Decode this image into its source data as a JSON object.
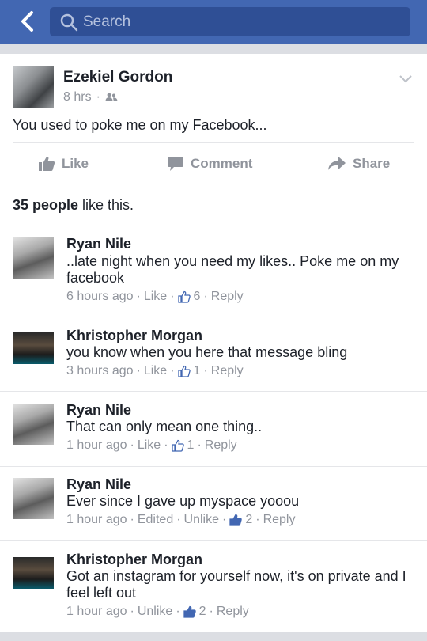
{
  "nav": {
    "search_placeholder": "Search"
  },
  "post": {
    "author": "Ezekiel Gordon",
    "time": "8 hrs",
    "text": "You used to poke me on my Facebook...",
    "actions": {
      "like": "Like",
      "comment": "Comment",
      "share": "Share"
    },
    "likes_count": "35 people",
    "likes_suffix": " like this."
  },
  "comments": [
    {
      "name": "Ryan Nile",
      "text": "..late night when you need my likes.. Poke me on my facebook",
      "time": "6 hours ago",
      "action": "Like",
      "likes": "6",
      "reply": "Reply"
    },
    {
      "name": "Khristopher Morgan",
      "text": "you know when you here that message bling",
      "time": "3 hours ago",
      "action": "Like",
      "likes": "1",
      "reply": "Reply"
    },
    {
      "name": "Ryan Nile",
      "text": "That can only mean one thing..",
      "time": "1 hour ago",
      "action": "Like",
      "likes": "1",
      "reply": "Reply"
    },
    {
      "name": "Ryan Nile",
      "text": "Ever since I gave up myspace yooou",
      "time": "1 hour ago",
      "edited": "Edited",
      "action": "Unlike",
      "likes": "2",
      "reply": "Reply"
    },
    {
      "name": "Khristopher Morgan",
      "text": "Got an instagram for yourself now, it's on private and I feel left out",
      "time": "1 hour ago",
      "action": "Unlike",
      "likes": "2",
      "reply": "Reply"
    }
  ],
  "colors": {
    "brand": "#4267b2",
    "search_bg": "#2f4f95",
    "meta": "#90949c",
    "liked_blue": "#4267b2"
  },
  "icons": [
    "back-chevron-icon",
    "search-icon",
    "chevron-down-icon",
    "friends-icon",
    "like-icon",
    "comment-icon",
    "share-icon",
    "thumbs-up-icon"
  ]
}
